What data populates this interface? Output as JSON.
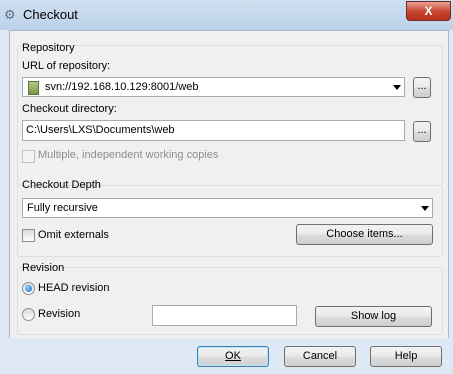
{
  "window": {
    "title": "Checkout",
    "icon": "svn-checkout-icon",
    "close_label": "X"
  },
  "repository": {
    "group_label": "Repository",
    "url_label": "URL of repository:",
    "url_value": "svn://192.168.10.129:8001/web",
    "url_browse_label": "...",
    "dir_label": "Checkout directory:",
    "dir_value": "C:\\Users\\LXS\\Documents\\web",
    "dir_browse_label": "...",
    "multiple_label": "Multiple, independent working copies",
    "multiple_checked": false,
    "multiple_enabled": false
  },
  "depth": {
    "group_label": "Checkout Depth",
    "depth_value": "Fully recursive",
    "omit_label": "Omit externals",
    "omit_checked": false,
    "choose_items_label": "Choose items..."
  },
  "revision": {
    "group_label": "Revision",
    "head_label": "HEAD revision",
    "head_selected": true,
    "revision_label": "Revision",
    "revision_value": "",
    "show_log_label": "Show log"
  },
  "buttons": {
    "ok_label": "OK",
    "cancel_label": "Cancel",
    "help_label": "Help"
  }
}
